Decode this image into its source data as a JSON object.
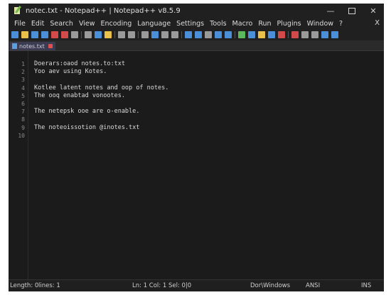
{
  "window": {
    "title": "notec.txt - Notepad++ | Notepad++ v8.5.9",
    "controls": {
      "minimize": "—",
      "close": "✕"
    }
  },
  "menubar": {
    "items": [
      "File",
      "Edit",
      "Search",
      "View",
      "Encoding",
      "Language",
      "Settings",
      "Tools",
      "Macro",
      "Run",
      "Plugins",
      "Window",
      "?"
    ],
    "close": "X"
  },
  "toolbar": {
    "icons": [
      "new-file-icon",
      "open-file-icon",
      "save-icon",
      "save-all-icon",
      "close-icon",
      "close-all-icon",
      "print-icon",
      "cut-icon",
      "copy-icon",
      "paste-icon",
      "undo-icon",
      "redo-icon",
      "find-icon",
      "replace-icon",
      "zoom-in-icon",
      "zoom-out-icon",
      "sync-v-icon",
      "sync-h-icon",
      "word-wrap-icon",
      "show-all-icon",
      "indent-guide-icon",
      "udl-icon",
      "doc-map-icon",
      "function-list-icon",
      "folder-workspace-icon",
      "monitor-icon",
      "record-icon",
      "stop-icon",
      "play-icon",
      "run-macro-icon",
      "save-macro-icon"
    ],
    "colors": {
      "blue": "#4a8fd8",
      "yellow": "#e8c04a",
      "red": "#d24a4a",
      "green": "#5bb85b",
      "gray": "#9a9a9a"
    }
  },
  "tabs": [
    {
      "label": "notes.txt"
    }
  ],
  "editor": {
    "line_numbers": [
      "1",
      "2",
      "3",
      "4",
      "5",
      "6",
      "7",
      "8",
      "9",
      "10"
    ],
    "lines": [
      "Doerars:oaod notes.to:txt",
      "Yoo aev using Kotes.",
      "",
      "Kotlee latent notes and oop of notes.",
      "The ooq enabtad vonootes.",
      "",
      "The netepsk ooe are o-enable.",
      "",
      "The noteoissotion @inotes.txt",
      ""
    ]
  },
  "statusbar": {
    "length": "Length: 0",
    "lines": "lines: 1",
    "position": "Ln: 1   Col: 1   Sel: 0|0",
    "eol": "Dor\\Windows",
    "encoding": "ANSI",
    "mode": "INS"
  }
}
